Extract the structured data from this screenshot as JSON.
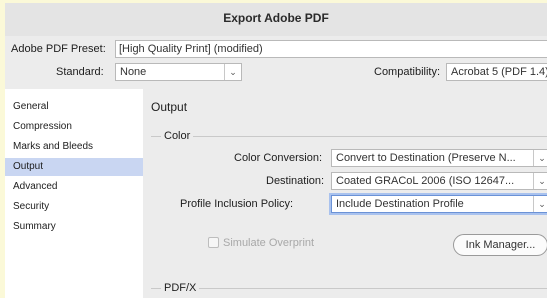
{
  "window": {
    "title": "Export Adobe PDF"
  },
  "preset": {
    "label": "Adobe PDF Preset:",
    "value": "[High Quality Print] (modified)"
  },
  "standard": {
    "label": "Standard:",
    "value": "None"
  },
  "compatibility": {
    "label": "Compatibility:",
    "value": "Acrobat 5 (PDF 1.4)"
  },
  "sidebar": {
    "items": [
      {
        "label": "General"
      },
      {
        "label": "Compression"
      },
      {
        "label": "Marks and Bleeds"
      },
      {
        "label": "Output",
        "selected": true
      },
      {
        "label": "Advanced"
      },
      {
        "label": "Security"
      },
      {
        "label": "Summary"
      }
    ]
  },
  "output": {
    "title": "Output",
    "color_group": "Color",
    "color_conversion": {
      "label": "Color Conversion:",
      "value": "Convert to Destination (Preserve N..."
    },
    "destination": {
      "label": "Destination:",
      "value": "Coated GRACoL 2006 (ISO 12647..."
    },
    "profile_policy": {
      "label": "Profile Inclusion Policy:",
      "value": "Include Destination Profile"
    },
    "simulate_overprint": {
      "label": "Simulate Overprint",
      "checked": false,
      "enabled": false
    },
    "ink_manager_label": "Ink Manager...",
    "pdfx_group": "PDF/X"
  },
  "colors": {
    "selection": "#c9d6f2",
    "focus_ring": "#a9c2ee",
    "window_bg": "#ececec"
  }
}
